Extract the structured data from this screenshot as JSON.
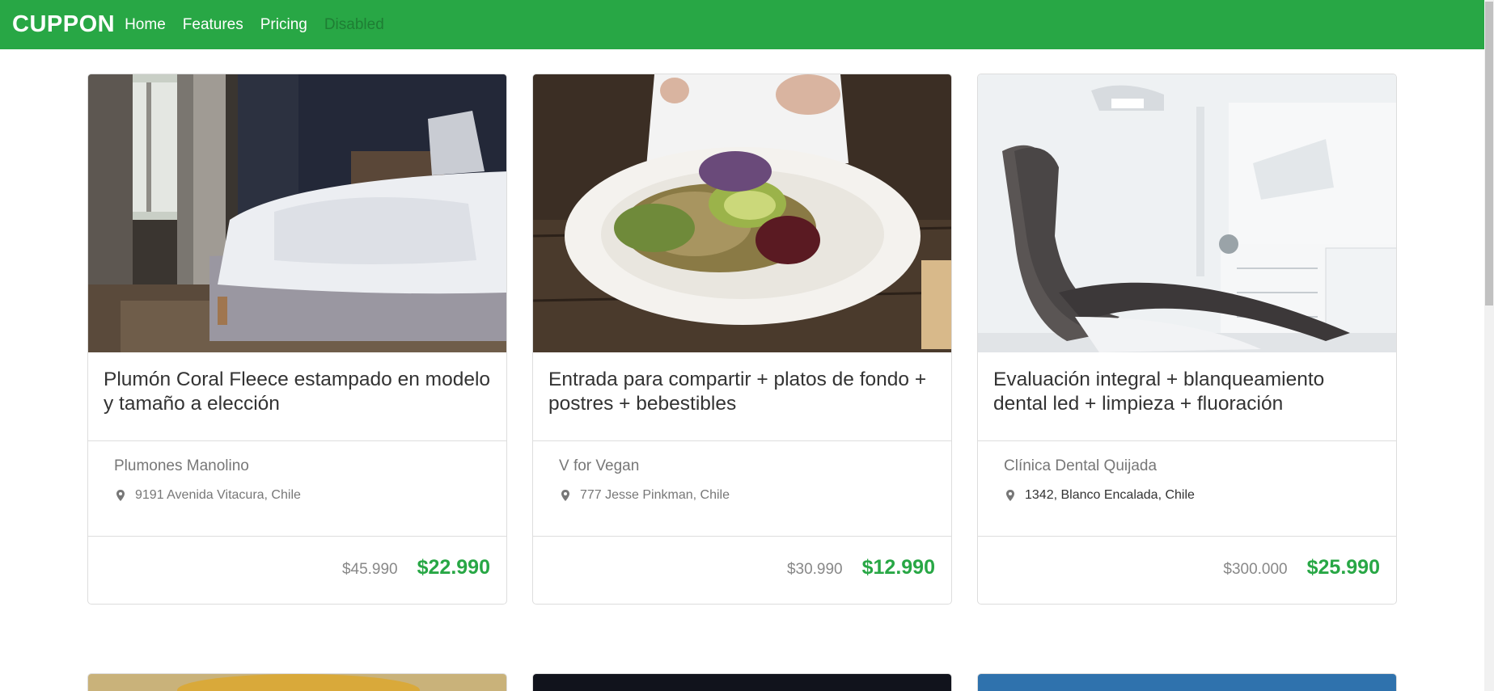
{
  "navbar": {
    "brand": "CUPPON",
    "links": [
      {
        "label": "Home"
      },
      {
        "label": "Features"
      },
      {
        "label": "Pricing"
      },
      {
        "label": "Disabled"
      }
    ]
  },
  "cards": [
    {
      "title": "Plumón Coral Fleece estampado en modelo y tamaño a elección",
      "merchant": "Plumones Manolino",
      "address": "9191 Avenida Vitacura, Chile",
      "old_price": "$45.990",
      "new_price": "$22.990",
      "image": "bedroom-photo"
    },
    {
      "title": "Entrada para compartir + platos de fondo + postres + bebestibles",
      "merchant": "V for Vegan",
      "address": "777 Jesse Pinkman, Chile",
      "old_price": "$30.990",
      "new_price": "$12.990",
      "image": "vegan-dish-photo"
    },
    {
      "title": "Evaluación integral + blanqueamiento dental led + limpieza + fluoración",
      "merchant": "Clínica Dental Quijada",
      "address": "1342, Blanco Encalada, Chile",
      "old_price": "$300.000",
      "new_price": "$25.990",
      "image": "dental-chair-photo"
    }
  ],
  "colors": {
    "navbar": "#28a745",
    "price": "#28a745"
  }
}
